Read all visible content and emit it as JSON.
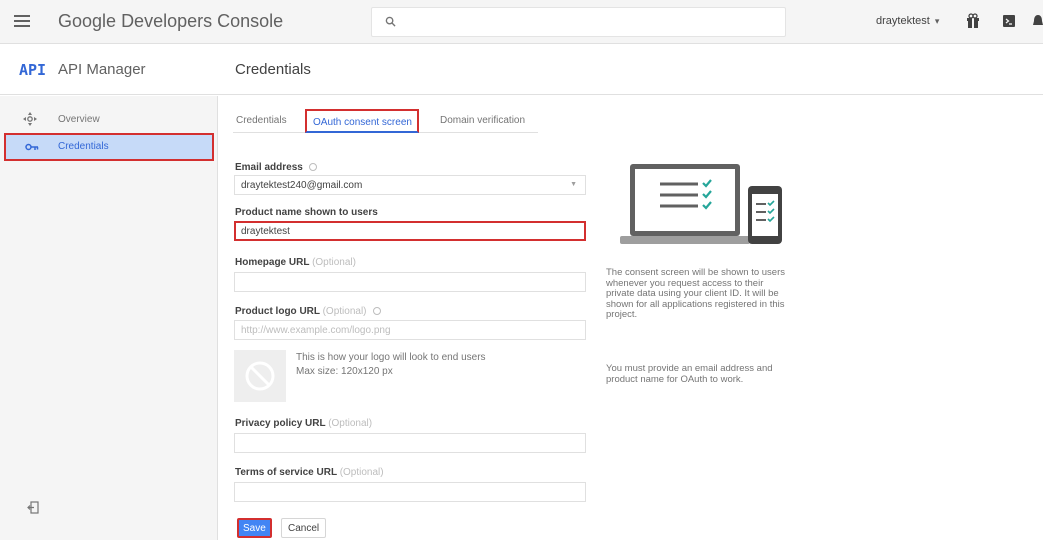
{
  "header": {
    "brand_google": "Google",
    "brand_rest": "Developers Console",
    "project_name": "draytektest",
    "project_caret": "▾"
  },
  "subheader": {
    "api_logo": "API",
    "section_title": "API Manager",
    "page_title": "Credentials"
  },
  "sidebar": {
    "items": [
      {
        "label": "Overview",
        "icon": "overview-icon"
      },
      {
        "label": "Credentials",
        "icon": "key-icon",
        "active": true
      }
    ]
  },
  "tabs": [
    {
      "label": "Credentials"
    },
    {
      "label": "OAuth consent screen",
      "active": true
    },
    {
      "label": "Domain verification"
    }
  ],
  "form": {
    "email": {
      "label": "Email address",
      "value": "draytektest240@gmail.com"
    },
    "product_name": {
      "label": "Product name shown to users",
      "value": "draytektest"
    },
    "homepage": {
      "label": "Homepage URL",
      "optional": "(Optional)",
      "value": ""
    },
    "logo": {
      "label": "Product logo URL",
      "optional": "(Optional)",
      "placeholder": "http://www.example.com/logo.png"
    },
    "logo_hint_1": "This is how your logo will look to end users",
    "logo_hint_2": "Max size: 120x120 px",
    "privacy": {
      "label": "Privacy policy URL",
      "optional": "(Optional)",
      "value": ""
    },
    "terms": {
      "label": "Terms of service URL",
      "optional": "(Optional)",
      "value": ""
    },
    "save_label": "Save",
    "cancel_label": "Cancel"
  },
  "info": {
    "paragraph_1": "The consent screen will be shown to users whenever you request access to their private data using your client ID. It will be shown for all applications registered in this project.",
    "paragraph_2": "You must provide an email address and product name for OAuth to work."
  },
  "colors": {
    "accent": "#3367d6",
    "highlight_border": "#d32f2f",
    "check_green": "#26a69a"
  }
}
